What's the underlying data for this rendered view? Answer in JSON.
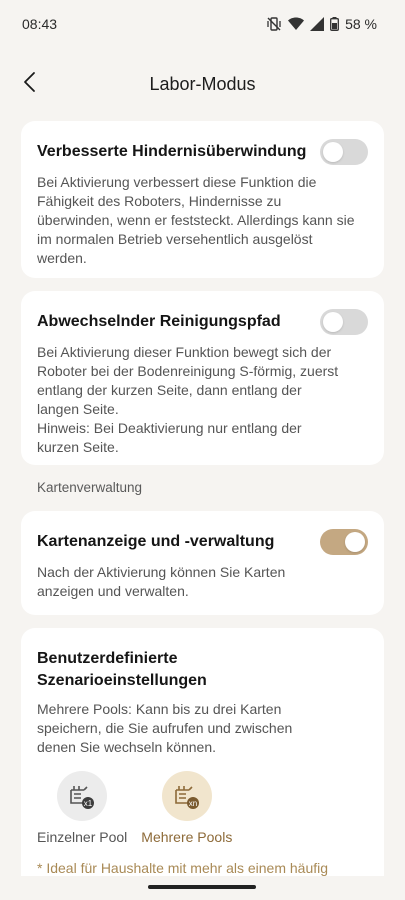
{
  "status_bar": {
    "time": "08:43",
    "battery": "58 %"
  },
  "header": {
    "title": "Labor-Modus"
  },
  "cards": {
    "obstacle": {
      "title": "Verbesserte Hindernisüberwindung",
      "description": "Bei Aktivierung verbessert diese Funktion die Fähigkeit des Roboters, Hindernisse zu überwinden, wenn er feststeckt. Allerdings kann sie im normalen Betrieb versehentlich ausgelöst werden.",
      "enabled": false
    },
    "path": {
      "title": "Abwechselnder Reinigungspfad",
      "description": "Bei Aktivierung dieser Funktion bewegt sich der Roboter bei der Bodenreinigung S-förmig, zuerst entlang der kurzen Seite, dann entlang der langen Seite.\nHinweis: Bei Deaktivierung nur entlang der kurzen Seite.",
      "enabled": false
    },
    "map": {
      "title": "Kartenanzeige und -verwaltung",
      "description": "Nach der Aktivierung können Sie Karten anzeigen und verwalten.",
      "enabled": true
    },
    "scenario": {
      "title": "Benutzerdefinierte Szenarioeinstellungen",
      "description": "Mehrere Pools: Kann bis zu drei Karten speichern, die Sie aufrufen und zwischen denen Sie wechseln können.",
      "options": [
        {
          "label": "Einzelner Pool",
          "badge": "x1",
          "selected": false
        },
        {
          "label": "Mehrere Pools",
          "badge": "xn",
          "selected": true
        }
      ],
      "footnote": "* Ideal für Haushalte mit mehr als einem häufig genutzten Pool."
    }
  },
  "sections": {
    "map_management": "Kartenverwaltung"
  },
  "colors": {
    "accent": "#c4a882",
    "accent_text": "#a98a56",
    "background": "#f6f4f1"
  }
}
